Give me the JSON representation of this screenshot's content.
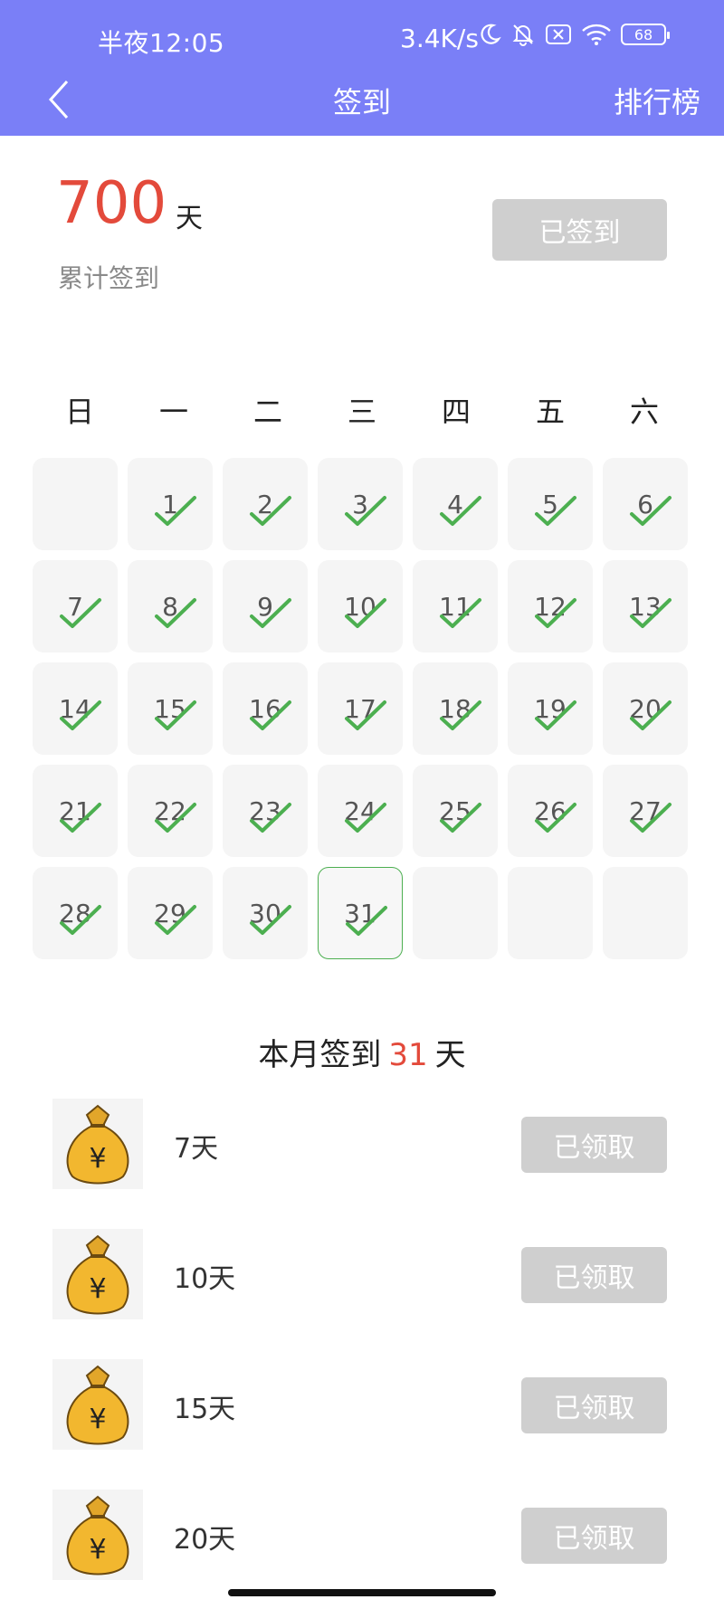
{
  "status_bar": {
    "time": "半夜12:05",
    "net_speed": "3.4K/s",
    "battery": "68"
  },
  "nav": {
    "title": "签到",
    "right_action": "排行榜"
  },
  "summary": {
    "total_days": "700",
    "unit": "天",
    "label": "累计签到",
    "button": "已签到"
  },
  "weekdays": [
    "日",
    "一",
    "二",
    "三",
    "四",
    "五",
    "六"
  ],
  "calendar": [
    {
      "day": "",
      "checked": false
    },
    {
      "day": "1",
      "checked": true
    },
    {
      "day": "2",
      "checked": true
    },
    {
      "day": "3",
      "checked": true
    },
    {
      "day": "4",
      "checked": true
    },
    {
      "day": "5",
      "checked": true
    },
    {
      "day": "6",
      "checked": true
    },
    {
      "day": "7",
      "checked": true
    },
    {
      "day": "8",
      "checked": true
    },
    {
      "day": "9",
      "checked": true
    },
    {
      "day": "10",
      "checked": true
    },
    {
      "day": "11",
      "checked": true
    },
    {
      "day": "12",
      "checked": true
    },
    {
      "day": "13",
      "checked": true
    },
    {
      "day": "14",
      "checked": true
    },
    {
      "day": "15",
      "checked": true
    },
    {
      "day": "16",
      "checked": true
    },
    {
      "day": "17",
      "checked": true
    },
    {
      "day": "18",
      "checked": true
    },
    {
      "day": "19",
      "checked": true
    },
    {
      "day": "20",
      "checked": true
    },
    {
      "day": "21",
      "checked": true
    },
    {
      "day": "22",
      "checked": true
    },
    {
      "day": "23",
      "checked": true
    },
    {
      "day": "24",
      "checked": true
    },
    {
      "day": "25",
      "checked": true
    },
    {
      "day": "26",
      "checked": true
    },
    {
      "day": "27",
      "checked": true
    },
    {
      "day": "28",
      "checked": true
    },
    {
      "day": "29",
      "checked": true
    },
    {
      "day": "30",
      "checked": true
    },
    {
      "day": "31",
      "checked": true,
      "today": true
    },
    {
      "day": "",
      "checked": false
    },
    {
      "day": "",
      "checked": false
    },
    {
      "day": "",
      "checked": false
    }
  ],
  "month_summary": {
    "prefix": "本月签到",
    "days": "31",
    "suffix": "天"
  },
  "rewards": [
    {
      "label": "7天",
      "button": "已领取"
    },
    {
      "label": "10天",
      "button": "已领取"
    },
    {
      "label": "15天",
      "button": "已领取"
    },
    {
      "label": "20天",
      "button": "已领取"
    }
  ],
  "colors": {
    "header": "#7a7ff7",
    "accent_red": "#e34a3b",
    "check_green": "#4caf50",
    "disabled_button": "#cfcfcf"
  }
}
